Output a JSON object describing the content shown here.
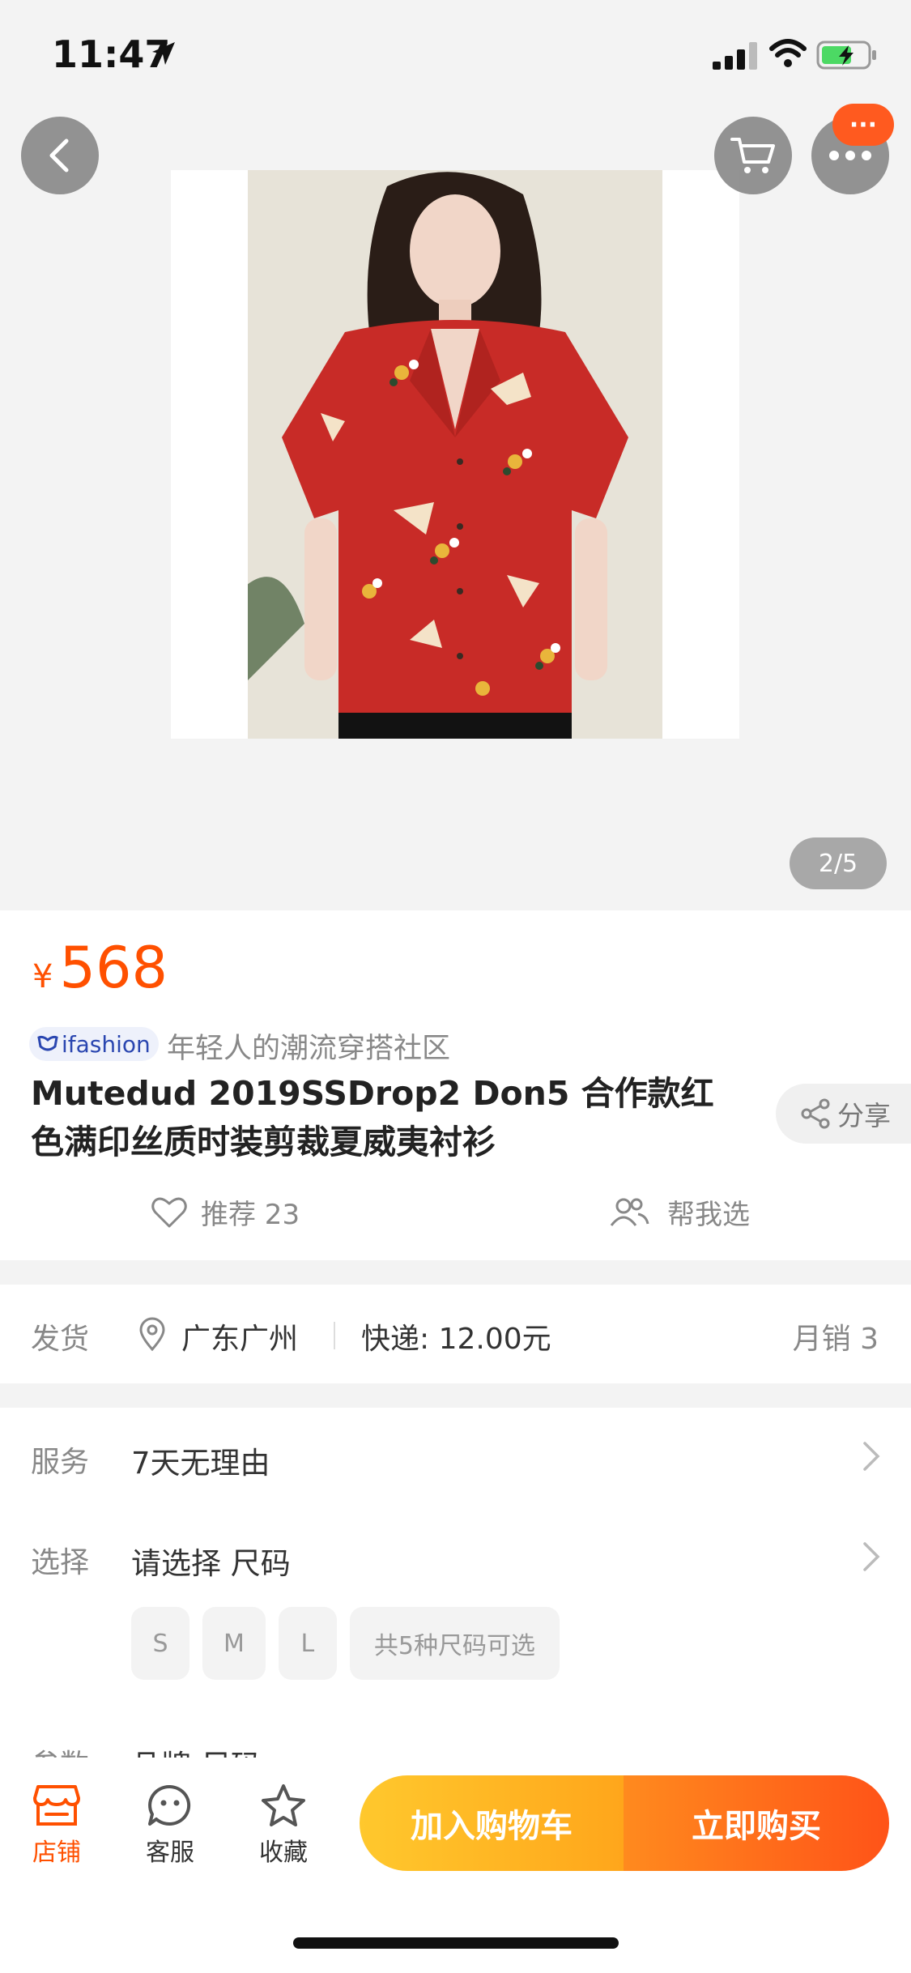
{
  "status_bar": {
    "time": "11:47"
  },
  "header": {
    "more_badge": "···"
  },
  "gallery": {
    "page_indicator": "2/5"
  },
  "product": {
    "currency": "¥",
    "price": "568",
    "brand_badge": "ifashion",
    "tagline": "年轻人的潮流穿搭社区",
    "title": "Mutedud 2019SSDrop2 Don5 合作款红色满印丝质时装剪裁夏威夷衬衫",
    "share_label": "分享",
    "recommend_label": "推荐 23",
    "help_choose_label": "帮我选"
  },
  "shipping": {
    "label": "发货",
    "location": "广东广州",
    "fee": "快递: 12.00元",
    "monthly_sales": "月销 3"
  },
  "services": {
    "service_label": "服务",
    "service_value": "7天无理由",
    "select_label": "选择",
    "select_value": "请选择 尺码",
    "sizes": [
      "S",
      "M",
      "L"
    ],
    "sizes_more": "共5种尺码可选",
    "params_label": "参数",
    "params_value": "品牌 尺码"
  },
  "bottom_bar": {
    "store": "店铺",
    "customer_service": "客服",
    "favorite": "收藏",
    "add_to_cart": "加入购物车",
    "buy_now": "立即购买"
  },
  "colors": {
    "accent": "#ff5000",
    "cart_button": "#ffb522",
    "buy_button": "#ff6a1c"
  }
}
